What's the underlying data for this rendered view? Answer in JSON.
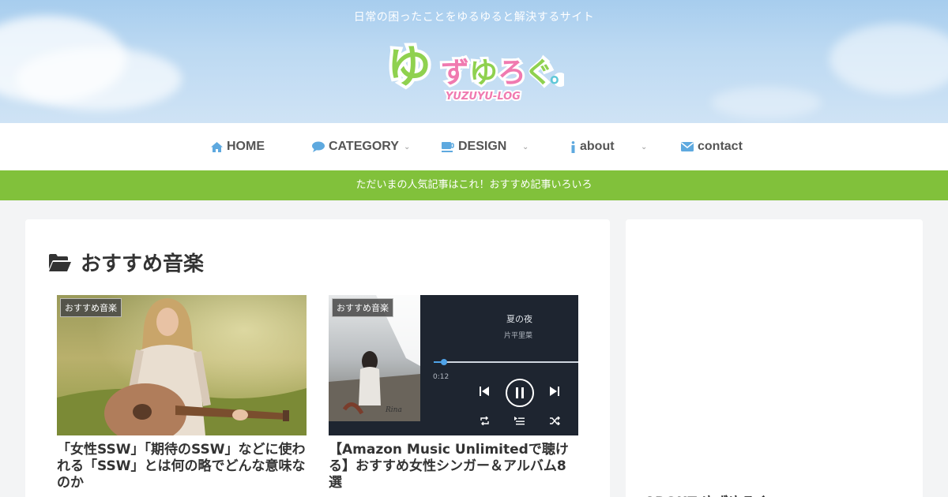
{
  "header": {
    "tagline": "日常の困ったことをゆるゆると解決するサイト",
    "logo": {
      "main": "ゆずゆろぐ。",
      "sub": "YUZUYU-LOG"
    }
  },
  "nav": {
    "items": [
      {
        "label": "HOME",
        "icon": "home-icon"
      },
      {
        "label": "CATEGORY",
        "icon": "comment-icon"
      },
      {
        "label": "DESIGN",
        "icon": "coffee-icon"
      },
      {
        "label": "about",
        "icon": "info-icon"
      },
      {
        "label": "contact",
        "icon": "envelope-icon"
      }
    ]
  },
  "notice": {
    "text": "ただいまの人気記事はこれ！おすすめ記事いろいろ"
  },
  "main": {
    "title": "おすすめ音楽",
    "entries": [
      {
        "category": "おすすめ音楽",
        "title": "「女性SSW」「期待のSSW」などに使われる「SSW」とは何の略でどんな意味なのか"
      },
      {
        "category": "おすすめ音楽",
        "title": "【Amazon Music Unlimitedで聴ける】おすすめ女性シンガー＆アルバム8選",
        "player": {
          "song": "夏の夜",
          "artist": "片平里菜",
          "time": "0:12"
        }
      }
    ]
  },
  "sidebar": {
    "heading": "ABOUT ゆずゆろぐ"
  },
  "colors": {
    "accent_green": "#81c13b",
    "icon_blue": "#5ea9df",
    "logo_green": "#8fd14f",
    "logo_pink": "#f07ab0"
  }
}
